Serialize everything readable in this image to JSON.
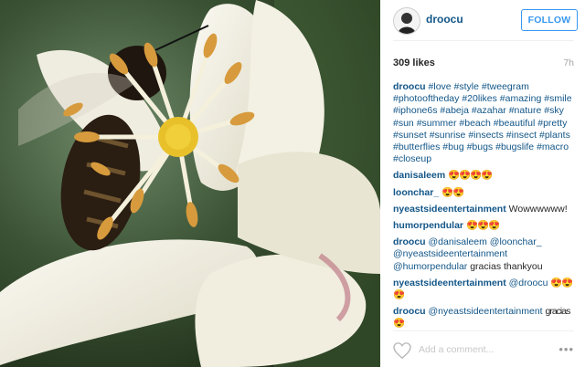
{
  "post": {
    "username": "droocu",
    "follow_label": "FOLLOW",
    "likes": "309 likes",
    "time": "7h"
  },
  "caption": {
    "user": "droocu",
    "tags": [
      "#love",
      "#style",
      "#tweegram",
      "#photooftheday",
      "#20likes",
      "#amazing",
      "#smile",
      "#iphone6s",
      "#abeja",
      "#azahar",
      "#nature",
      "#sky",
      "#sun",
      "#summer",
      "#beach",
      "#beautiful",
      "#pretty",
      "#sunset",
      "#sunrise",
      "#insects",
      "#insect",
      "#plants",
      "#butterflies",
      "#bug",
      "#bugs",
      "#bugslife",
      "#macro",
      "#closeup"
    ]
  },
  "comments": [
    {
      "user": "danisaleem",
      "text": "😍😍😍😍"
    },
    {
      "user": "loonchar_",
      "text": "😍😍"
    },
    {
      "user": "nyeastsideentertainment",
      "text": "Wowwwwww!"
    },
    {
      "user": "humorpendular",
      "text": "😍😍😍"
    },
    {
      "user": "droocu",
      "mentions": [
        "@danisaleem",
        "@loonchar_",
        "@nyeastsideentertainment",
        "@humorpendular"
      ],
      "text": "gracias thankyou"
    },
    {
      "user": "nyeastsideentertainment",
      "mentions": [
        "@droocu"
      ],
      "text": "😍😍😍"
    },
    {
      "user": "droocu",
      "mentions": [
        "@nyeastsideentertainment"
      ],
      "text": "gracias 😍"
    }
  ],
  "footer": {
    "add_comment_placeholder": "Add a comment...",
    "more_label": "•••"
  },
  "colors": {
    "link": "#125688",
    "follow": "#3897f0"
  }
}
